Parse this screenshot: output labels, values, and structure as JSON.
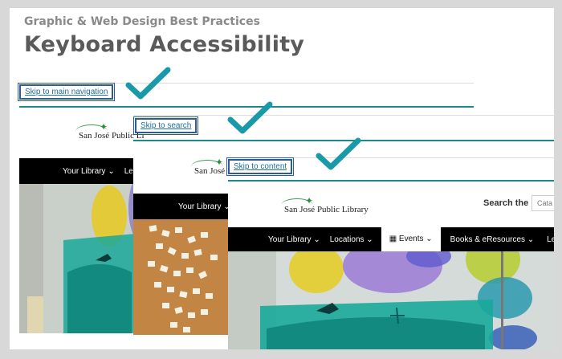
{
  "header": {
    "kicker": "Graphic & Web Design Best Practices",
    "title": "Keyboard Accessibility"
  },
  "links": {
    "main_nav": "Skip to main navigation",
    "search": "Skip to search",
    "content": "Skip to content"
  },
  "logo_text": "San José Public Library",
  "logo_partial_1": "San José Public Li",
  "logo_partial_2": "San José",
  "search_label": "Search the",
  "search_placeholder": "Cata",
  "nav_back": {
    "item1": "Your Library ⌄",
    "item2": "Le"
  },
  "nav_mid": {
    "item1": "Your Library ⌄"
  },
  "nav_front": {
    "items": [
      "Your Library ⌄",
      "Locations ⌄",
      "Events ⌄",
      "Books & eResources ⌄",
      "Learning ⌄"
    ]
  },
  "colors": {
    "accent": "#1a8a8a",
    "check": "#1a9aa8",
    "nav": "#000000"
  }
}
